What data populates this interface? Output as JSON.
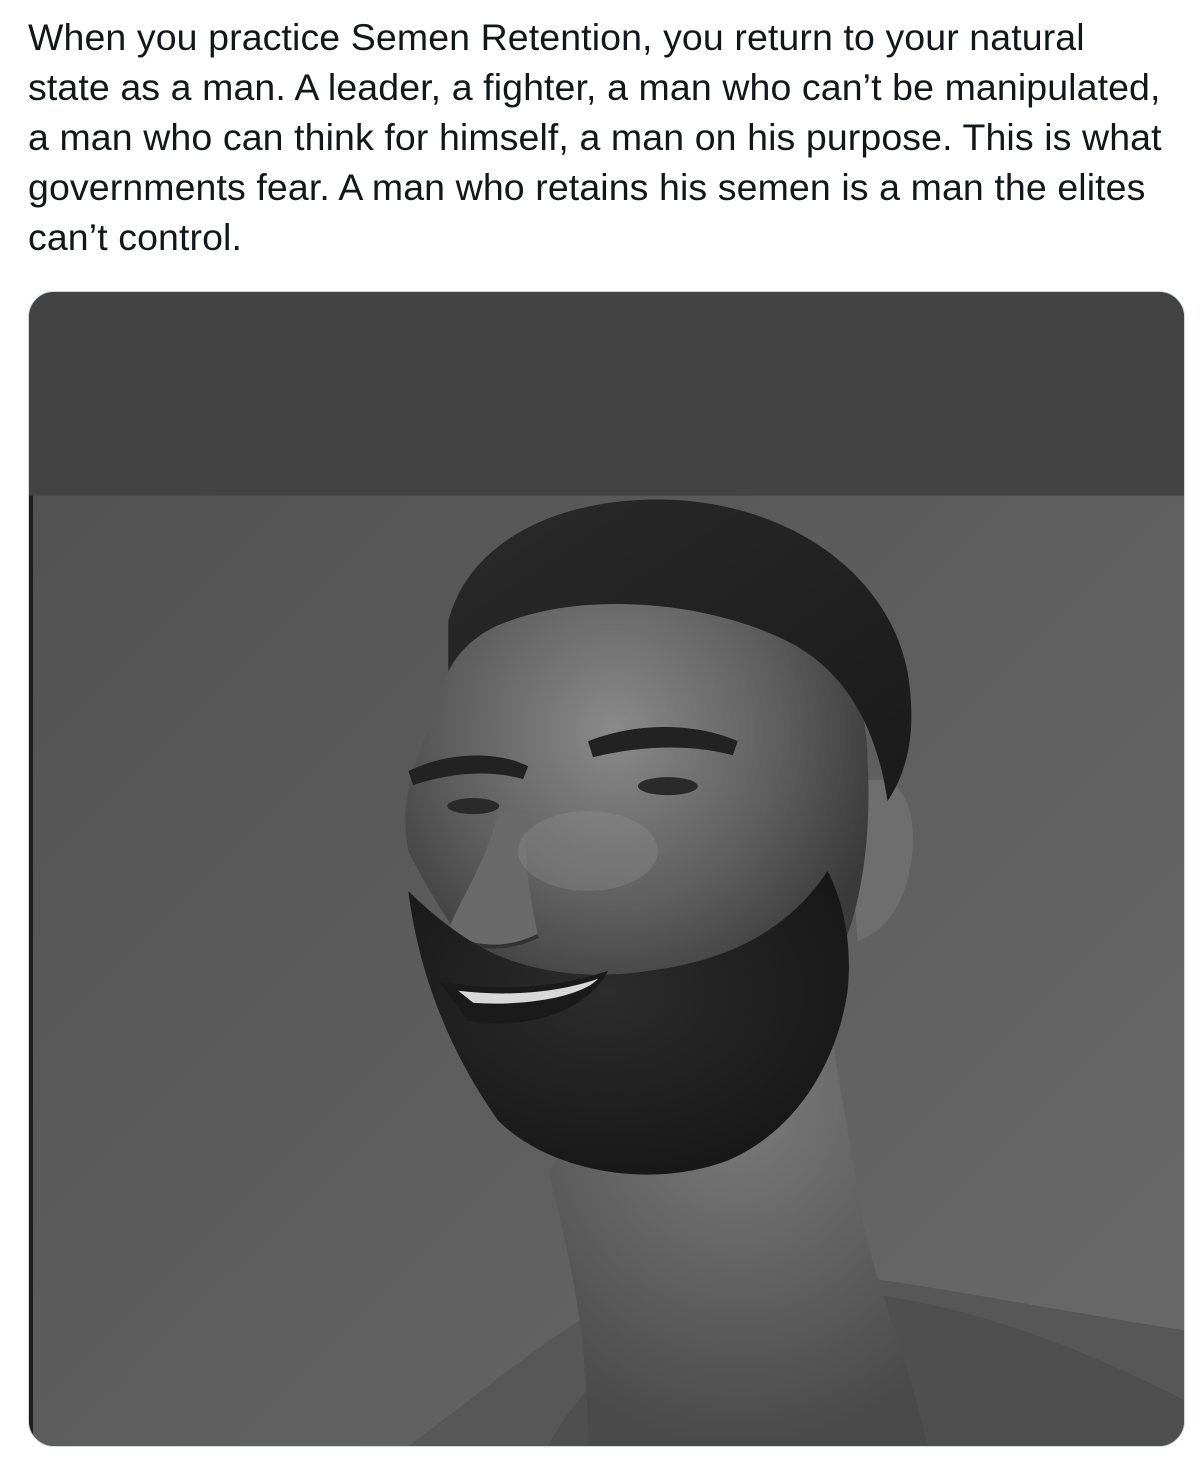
{
  "tweet": {
    "text_lines": [
      "When you practice Semen Retention, you return to your natural",
      "state as a man. A leader, a fighter, a man who can’t be manipulated,",
      "a man who can think for himself, a man on his purpose. This is what",
      "governments fear. A man who retains his semen is a man the elites",
      "can’t control."
    ]
  },
  "media": {
    "description_icon": "photo-image",
    "colors": {
      "top_band": "#434343",
      "background": "#5a5a5a",
      "border": "#cfd9de",
      "text": "#14171a"
    }
  }
}
